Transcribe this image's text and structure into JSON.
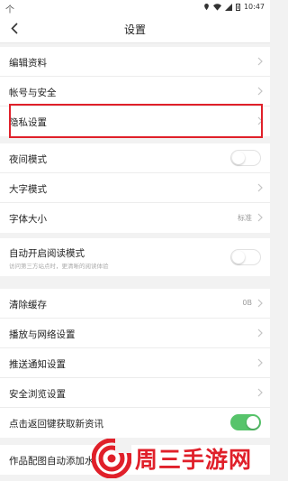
{
  "statusbar": {
    "left_glyph": "个",
    "time": "10:47"
  },
  "header": {
    "title": "设置"
  },
  "group1": [
    {
      "label": "编辑资料"
    },
    {
      "label": "帐号与安全"
    },
    {
      "label": "隐私设置"
    }
  ],
  "group2": {
    "night_mode": "夜间模式",
    "large_text_mode": "大字模式",
    "font_size": {
      "label": "字体大小",
      "value": "标准"
    }
  },
  "group3": {
    "auto_reader": {
      "label": "自动开启阅读模式",
      "sub": "访问第三方站点时，更清晰的阅读体验"
    }
  },
  "group4": {
    "clear_cache": {
      "label": "清除缓存",
      "value": "0B"
    },
    "playback_network": "播放与网络设置",
    "push_notify": "推送通知设置",
    "safe_browse": "安全浏览设置",
    "back_refresh": "点击返回键获取新资讯"
  },
  "group5": {
    "auto_add": "作品配图自动添加水"
  },
  "watermark": {
    "text": "周三手游网"
  },
  "colors": {
    "accent_red": "#e0202a",
    "toggle_on": "#57c46b"
  },
  "toggles": {
    "night_mode": false,
    "auto_reader": false,
    "back_refresh": true
  }
}
